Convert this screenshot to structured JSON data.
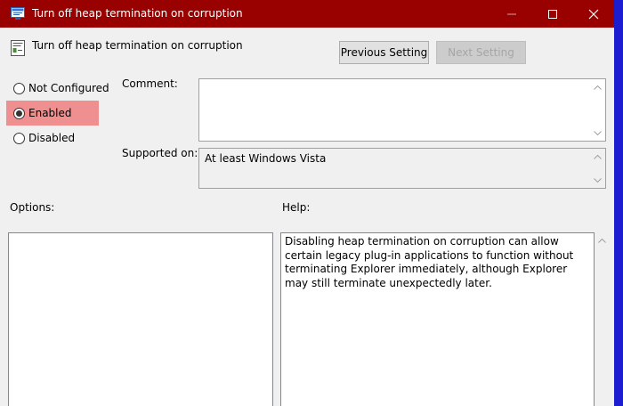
{
  "window": {
    "title": "Turn off heap termination on corruption"
  },
  "header": {
    "setting_title": "Turn off heap termination on corruption",
    "previous_button": "Previous Setting",
    "next_button": "Next Setting"
  },
  "state_options": [
    {
      "label": "Not Configured",
      "selected": false
    },
    {
      "label": "Enabled",
      "selected": true
    },
    {
      "label": "Disabled",
      "selected": false
    }
  ],
  "comment": {
    "label": "Comment:",
    "value": ""
  },
  "supported": {
    "label": "Supported on:",
    "value": "At least Windows Vista"
  },
  "options_label": "Options:",
  "help": {
    "label": "Help:",
    "text": "Disabling heap termination on corruption can allow certain legacy plug-in applications to function without terminating Explorer immediately, although Explorer may still terminate unexpectedly later."
  },
  "colors": {
    "titlebar": "#990000",
    "selected_highlight": "#f08f8f",
    "window_bg": "#f0f0f0"
  }
}
